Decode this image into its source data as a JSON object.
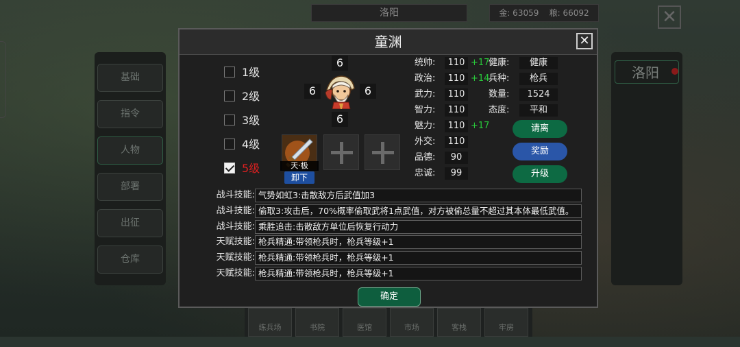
{
  "background": {
    "city_title": "洛阳",
    "resources": "金: 63059    粮: 66092",
    "side_city": "洛阳",
    "left_menu": [
      "基础",
      "指令",
      "人物",
      "部署",
      "出征",
      "仓库"
    ],
    "bottom_buildings": [
      "练兵场",
      "书院",
      "医馆",
      "市场",
      "客栈",
      "牢房"
    ]
  },
  "dialog": {
    "title": "童渊",
    "levels": [
      {
        "label": "1级",
        "checked": false
      },
      {
        "label": "2级",
        "checked": false
      },
      {
        "label": "3级",
        "checked": false
      },
      {
        "label": "4级",
        "checked": false
      },
      {
        "label": "5级",
        "checked": true
      }
    ],
    "portrait_numbers": {
      "top": "6",
      "left": "6",
      "right": "6",
      "bottom": "6"
    },
    "item": {
      "tag": "天·极",
      "unequip_label": "卸下"
    },
    "stats_left": [
      {
        "label": "统帅:",
        "value": "110",
        "bonus": "+17"
      },
      {
        "label": "政治:",
        "value": "110",
        "bonus": "+14"
      },
      {
        "label": "武力:",
        "value": "110",
        "bonus": ""
      },
      {
        "label": "智力:",
        "value": "110",
        "bonus": ""
      },
      {
        "label": "魅力:",
        "value": "110",
        "bonus": "+17"
      },
      {
        "label": "外交:",
        "value": "110",
        "bonus": ""
      },
      {
        "label": "品德:",
        "value": "90",
        "bonus": ""
      },
      {
        "label": "忠诚:",
        "value": "99",
        "bonus": ""
      }
    ],
    "stats_right": [
      {
        "label": "健康:",
        "value": "健康"
      },
      {
        "label": "兵种:",
        "value": "枪兵"
      },
      {
        "label": "数量:",
        "value": "1524"
      },
      {
        "label": "态度:",
        "value": "平和"
      }
    ],
    "buttons": {
      "dismiss": "请离",
      "reward": "奖励",
      "upgrade": "升级",
      "confirm": "确定"
    },
    "skills": [
      {
        "type": "战斗技能:",
        "text": "气势如虹3:击散敌方后武值加3"
      },
      {
        "type": "战斗技能:",
        "text": "偷取3:攻击后，70%概率偷取武将1点武值，对方被偷总量不超过其本体最低武值。"
      },
      {
        "type": "战斗技能:",
        "text": "乘胜追击:击散敌方单位后恢复行动力"
      },
      {
        "type": "天赋技能:",
        "text": "枪兵精通:带领枪兵时，枪兵等级+1"
      },
      {
        "type": "天赋技能:",
        "text": "枪兵精通:带领枪兵时，枪兵等级+1"
      },
      {
        "type": "天赋技能:",
        "text": "枪兵精通:带领枪兵时，枪兵等级+1"
      }
    ],
    "colors": {
      "checked_level": "#e02020",
      "bonus": "#29c93a",
      "dismiss_btn": "#0d6a43",
      "reward_btn": "#2a56a8",
      "upgrade_btn": "#0d6a43"
    }
  }
}
